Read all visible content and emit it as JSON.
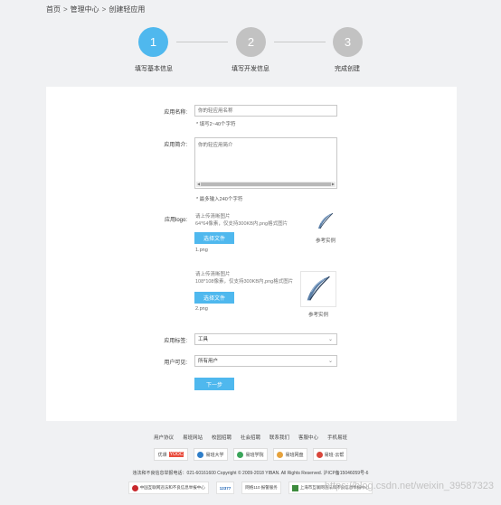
{
  "breadcrumb": {
    "home": "首页",
    "manage": "管理中心",
    "current": "创建轻应用",
    "sep": ">"
  },
  "steps": [
    {
      "num": "1",
      "label": "填写基本信息",
      "color": "#4fb8ee"
    },
    {
      "num": "2",
      "label": "填写开发信息",
      "color": "#c2c2c2"
    },
    {
      "num": "3",
      "label": "完成创建",
      "color": "#c2c2c2"
    }
  ],
  "form": {
    "name_label": "应用名称:",
    "name_value": "你的轻应用名称",
    "name_hint": "* 填写2~40个字符",
    "intro_label": "应用简介:",
    "intro_value": "你的轻应用简介",
    "intro_hint": "* 最多输入240个字符",
    "logo_label": "应用logo:",
    "logo1_line1": "请上传清晰图片",
    "logo1_line2": "64*64像素，仅支持300KB内,png格式图片",
    "logo1_button": "选择文件",
    "logo1_file": "1.png",
    "logo1_example": "参考实例",
    "logo2_line1": "请上传清晰图片",
    "logo2_line2": "108*108像素，仅支持300KB内,png格式图片",
    "logo2_button": "选择文件",
    "logo2_file": "2.png",
    "logo2_example": "参考实例",
    "tag_label": "应用标签:",
    "tag_value": "工具",
    "visible_label": "用户可见:",
    "visible_value": "所有用户",
    "next_button": "下一步"
  },
  "footer": {
    "links": [
      "用户协议",
      "易班网站",
      "校园招聘",
      "社会招聘",
      "联系我们",
      "客服中心",
      "手机易班"
    ],
    "partners": [
      {
        "name": "YOOC",
        "prefix": "优课",
        "color": "#e94c3d"
      },
      {
        "name": "易班大学",
        "prefix": "",
        "color": "#2f7ec9"
      },
      {
        "name": "易班学院",
        "prefix": "",
        "color": "#3aa55a"
      },
      {
        "name": "易班网盘",
        "prefix": "",
        "color": "#e6a23c"
      },
      {
        "name": "易班·云帮",
        "prefix": "",
        "color": "#d9463b"
      }
    ],
    "copyright": "违法和不良信息举报电话：021-60161600 Copyright © 2009-2018 YIBAN. All Rights Reserved. 沪ICP备15046059号-6",
    "badges": [
      "中国互联网违法和不良信息举报中心",
      "12377",
      "网络110 报警服务",
      "上海市互联网违法和不良信息举报中心"
    ],
    "watermark": "https://blog.csdn.net/weixin_39587323"
  }
}
